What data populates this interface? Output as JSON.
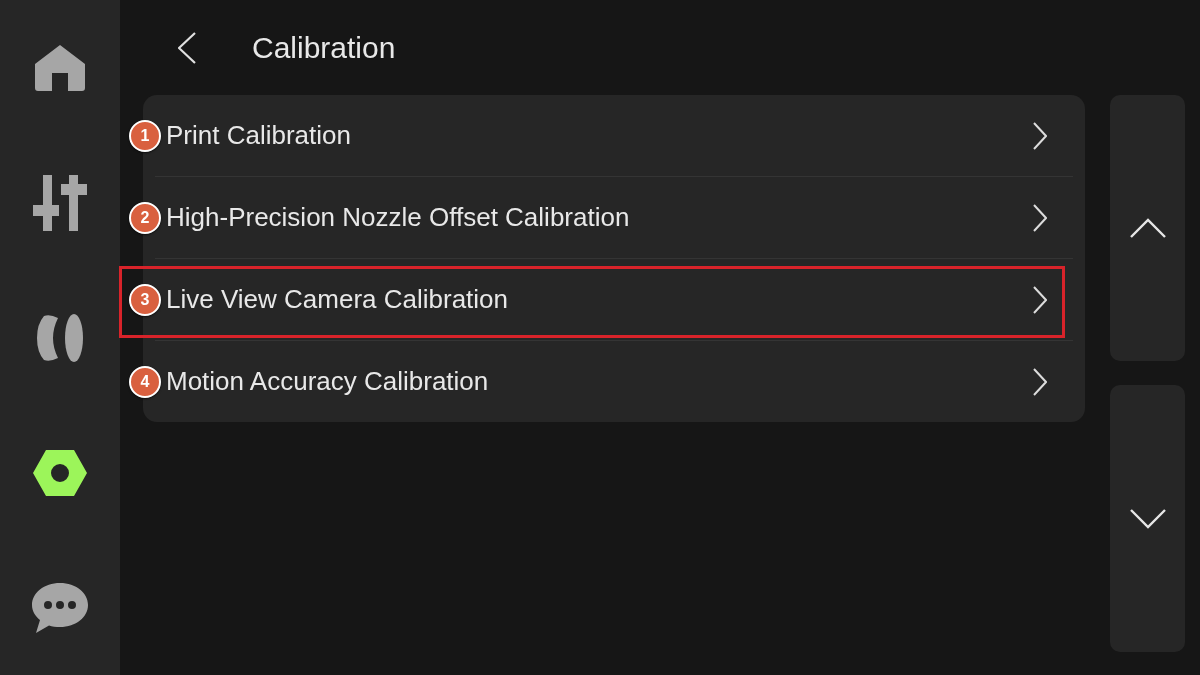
{
  "sidebar": {
    "items": [
      {
        "kind": "home",
        "selected": false
      },
      {
        "kind": "sliders",
        "selected": false
      },
      {
        "kind": "spool",
        "selected": false
      },
      {
        "kind": "nut",
        "selected": true
      },
      {
        "kind": "chat",
        "selected": false
      }
    ]
  },
  "header": {
    "title": "Calibration"
  },
  "menu": {
    "items": [
      {
        "marker": "1",
        "label": "Print Calibration",
        "highlighted": false
      },
      {
        "marker": "2",
        "label": "High-Precision Nozzle Offset Calibration",
        "highlighted": false
      },
      {
        "marker": "3",
        "label": "Live View Camera Calibration",
        "highlighted": true
      },
      {
        "marker": "4",
        "label": "Motion Accuracy Calibration",
        "highlighted": false
      }
    ]
  }
}
